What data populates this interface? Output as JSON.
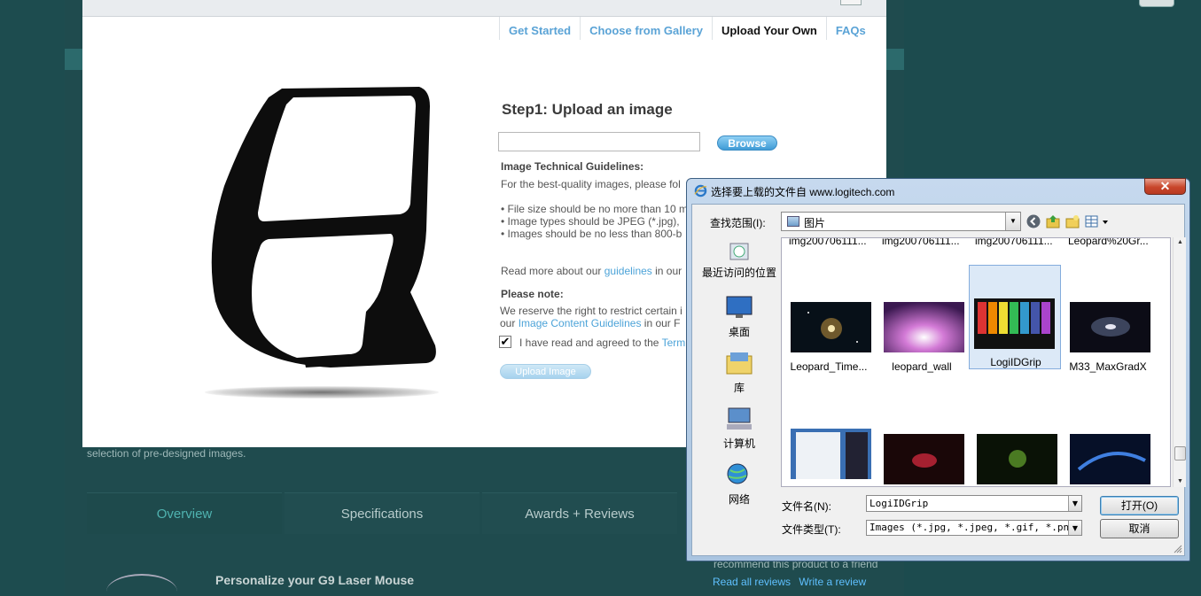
{
  "site": {
    "description_fragment": "selection of pre-designed images.",
    "tabs": [
      {
        "label": "Overview",
        "active": true
      },
      {
        "label": "Specifications",
        "active": false
      },
      {
        "label": "Awards + Reviews",
        "active": false
      }
    ],
    "personalize_heading": "Personalize your G9 Laser Mouse",
    "recommend_fragment": "recommend this product to a friend",
    "read_reviews_link": "Read all reviews",
    "write_review_link": "Write a review"
  },
  "modal": {
    "nav": [
      "Get Started",
      "Choose from Gallery",
      "Upload Your Own",
      "FAQs"
    ],
    "active_nav": "Upload Your Own",
    "step_title": "Step1: Upload an image",
    "browse_label": "Browse",
    "guidelines_heading": "Image Technical Guidelines:",
    "guidelines_intro": "For the best-quality images, please fol",
    "bullets": [
      "• File size should be no more than 10 m",
      "• Image types should be JPEG (*.jpg),",
      "• Images should be no less than 800-b"
    ],
    "readmore_prefix": "Read more about our ",
    "readmore_link": "guidelines",
    "readmore_suffix": " in our",
    "note_heading": "Please note:",
    "note_line1": "We reserve the right to restrict certain i",
    "note_line2_prefix": "our ",
    "note_line2_link": "Image Content Guidelines",
    "note_line2_suffix": " in our F",
    "agree_prefix": "I have read and agreed to the ",
    "agree_link": "Term",
    "agree_checked": true,
    "upload_label": "Upload Image"
  },
  "dialog": {
    "title": "选择要上载的文件自 www.logitech.com",
    "close_glyph": "✕",
    "lookin_label": "查找范围(I):",
    "lookin_value": "图片",
    "places": [
      "最近访问的位置",
      "桌面",
      "库",
      "计算机",
      "网络"
    ],
    "cut_labels": [
      "img200706111...",
      "img200706111...",
      "img200706111...",
      "Leopard%20Gr..."
    ],
    "files": [
      {
        "name": "Leopard_Time...",
        "selected": false
      },
      {
        "name": "leopard_wall",
        "selected": false
      },
      {
        "name": "LogiIDGrip",
        "selected": true
      },
      {
        "name": "M33_MaxGradX",
        "selected": false
      }
    ],
    "filename_label": "文件名(N):",
    "filename_value": "LogiIDGrip",
    "filetype_label": "文件类型(T):",
    "filetype_value": "Images (*.jpg, *.jpeg, *.gif, *.png)",
    "open_label": "打开(O)",
    "cancel_label": "取消"
  }
}
